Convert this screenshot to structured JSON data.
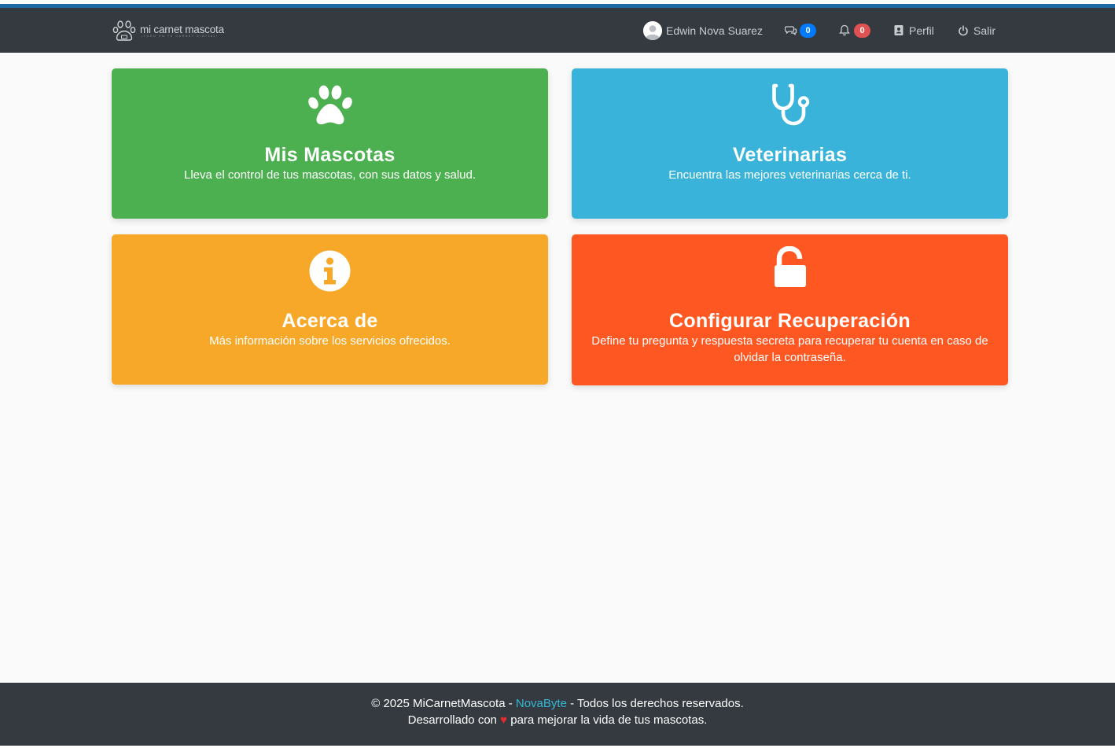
{
  "brand": {
    "title": "mi carnet mascota",
    "subtitle": "¡TODO EN TU CARNET DIGITAL!"
  },
  "nav": {
    "user_name": "Edwin Nova Suarez",
    "messages_count": "0",
    "notifications_count": "0",
    "profile_label": "Perfil",
    "logout_label": "Salir"
  },
  "cards": [
    {
      "title": "Mis Mascotas",
      "description": "Lleva el control de tus mascotas, con sus datos y salud.",
      "icon": "paw-icon",
      "color": "#4caf50"
    },
    {
      "title": "Veterinarias",
      "description": "Encuentra las mejores veterinarias cerca de ti.",
      "icon": "stethoscope-icon",
      "color": "#3ab3da"
    },
    {
      "title": "Acerca de",
      "description": "Más información sobre los servicios ofrecidos.",
      "icon": "info-circle-icon",
      "color": "#f8a828"
    },
    {
      "title": "Configurar Recuperación",
      "description": "Define tu pregunta y respuesta secreta para recuperar tu cuenta en caso de olvidar la contraseña.",
      "icon": "unlock-icon",
      "color": "#ff5722"
    }
  ],
  "footer": {
    "line1_prefix": "© 2025 MiCarnetMascota - ",
    "line1_link": "NovaByte",
    "line1_suffix": " - Todos los derechos reservados.",
    "line2_prefix": "Desarrollado con ",
    "line2_heart": "♥",
    "line2_suffix": " para mejorar la vida de tus mascotas."
  }
}
